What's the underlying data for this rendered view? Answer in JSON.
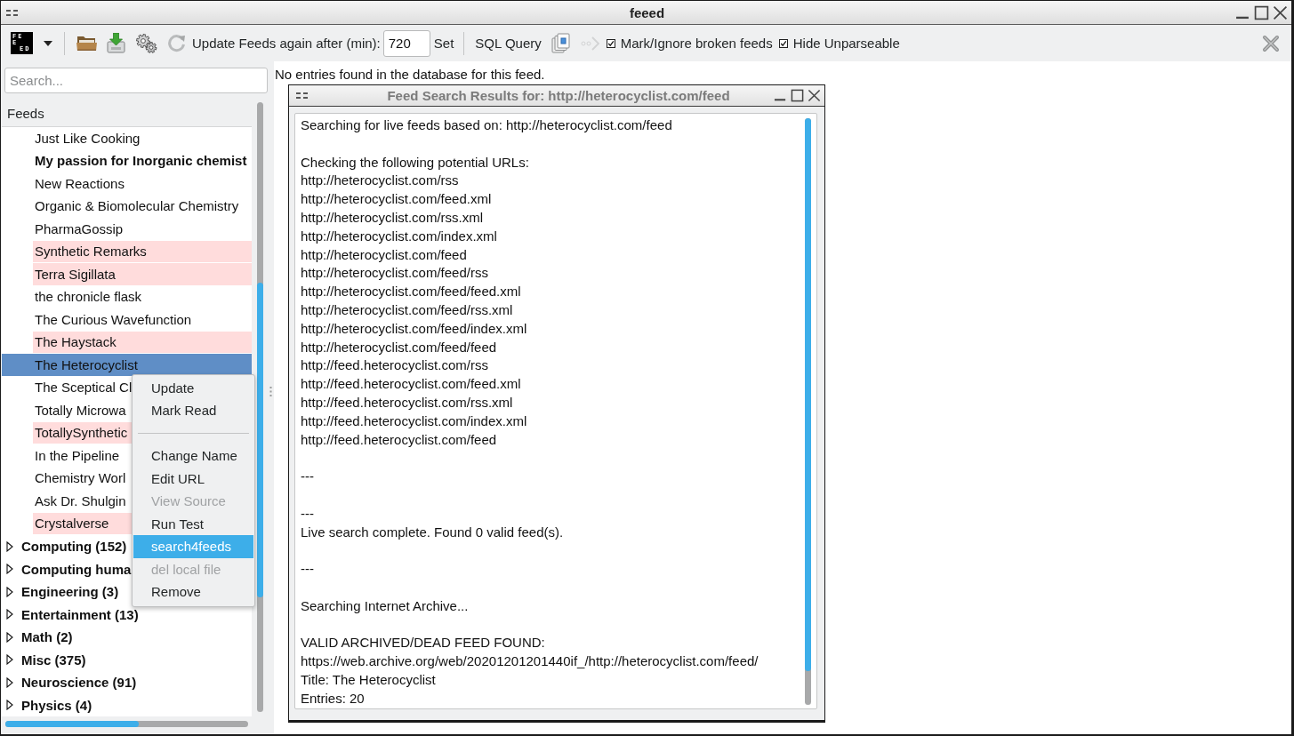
{
  "window": {
    "title": "feeed"
  },
  "toolbar": {
    "logo": [
      "FE",
      "E",
      "ED"
    ],
    "update_label": "Update Feeds again after (min):",
    "update_value": "720",
    "set_button": "Set",
    "sql_button": "SQL Query",
    "checkboxes": [
      {
        "label": "Mark/Ignore broken feeds",
        "checked": true
      },
      {
        "label": "Hide Unparseable",
        "checked": true
      }
    ]
  },
  "sidebar": {
    "search": {
      "placeholder": "Search..."
    },
    "tree": {
      "header": "Feeds",
      "items": [
        {
          "children": [
            {
              "label": "Just Like Cooking",
              "unread": false,
              "broken": false,
              "selected": false
            },
            {
              "label": "My passion for Inorganic chemist",
              "unread": true,
              "broken": false,
              "selected": false
            },
            {
              "label": "New Reactions",
              "unread": false,
              "broken": false,
              "selected": false
            },
            {
              "label": "Organic & Biomolecular Chemistry",
              "unread": false,
              "broken": false,
              "selected": false
            },
            {
              "label": "PharmaGossip",
              "unread": false,
              "broken": false,
              "selected": false
            },
            {
              "label": "Synthetic Remarks",
              "unread": false,
              "broken": true,
              "selected": false
            },
            {
              "label": "Terra Sigillata",
              "unread": false,
              "broken": true,
              "selected": false
            },
            {
              "label": "the chronicle flask",
              "unread": false,
              "broken": false,
              "selected": false
            },
            {
              "label": "The Curious Wavefunction",
              "unread": false,
              "broken": false,
              "selected": false
            },
            {
              "label": "The Haystack",
              "unread": false,
              "broken": true,
              "selected": false
            },
            {
              "label": "The Heterocyclist",
              "unread": false,
              "broken": false,
              "selected": true
            },
            {
              "label": "The Sceptical Cl",
              "unread": false,
              "broken": false,
              "selected": false
            },
            {
              "label": "Totally Microwa",
              "unread": false,
              "broken": false,
              "selected": false
            },
            {
              "label": "TotallySynthetic",
              "unread": false,
              "broken": true,
              "selected": false
            },
            {
              "label": "In the Pipeline",
              "unread": false,
              "broken": false,
              "selected": false
            },
            {
              "label": "Chemistry Worl",
              "unread": false,
              "broken": false,
              "selected": false
            },
            {
              "label": "Ask Dr. Shulgin",
              "unread": false,
              "broken": false,
              "selected": false
            },
            {
              "label": "Crystalverse",
              "unread": false,
              "broken": true,
              "selected": false
            }
          ]
        },
        {
          "label": "Computing (152)",
          "expanded": false,
          "selected": false
        },
        {
          "label": "Computing huma",
          "expanded": false,
          "selected": false
        },
        {
          "label": "Engineering (3)",
          "expanded": false,
          "selected": false
        },
        {
          "label": "Entertainment (13)",
          "expanded": false,
          "selected": false
        },
        {
          "label": "Math (2)",
          "expanded": false,
          "selected": false
        },
        {
          "label": "Misc (375)",
          "expanded": false,
          "selected": false
        },
        {
          "label": "Neuroscience (91)",
          "expanded": false,
          "selected": false
        },
        {
          "label": "Physics (4)",
          "expanded": false,
          "selected": false
        }
      ]
    }
  },
  "context_menu": {
    "items": [
      {
        "kind": "action",
        "label": "Update",
        "disabled": false,
        "selected": false
      },
      {
        "kind": "action",
        "label": "Mark Read",
        "disabled": false,
        "selected": false
      },
      {
        "kind": "separator"
      },
      {
        "kind": "action",
        "label": "Change Name",
        "disabled": false,
        "selected": false
      },
      {
        "kind": "action",
        "label": "Edit URL",
        "disabled": false,
        "selected": false
      },
      {
        "kind": "action",
        "label": "View Source",
        "disabled": true,
        "selected": false
      },
      {
        "kind": "action",
        "label": "Run Test",
        "disabled": false,
        "selected": false
      },
      {
        "kind": "action",
        "label": "search4feeds",
        "disabled": false,
        "selected": true
      },
      {
        "kind": "action",
        "label": "del local file",
        "disabled": true,
        "selected": false
      },
      {
        "kind": "action",
        "label": "Remove",
        "disabled": false,
        "selected": false
      }
    ]
  },
  "content": {
    "message": "No entries found in the database for this feed."
  },
  "dialog": {
    "title": "Feed Search Results for: http://heterocyclist.com/feed",
    "active": false,
    "blocks": [
      [
        "Searching for live feeds based on: http://heterocyclist.com/feed"
      ],
      [
        "Checking the following potential URLs:",
        "http://heterocyclist.com/rss",
        "http://heterocyclist.com/feed.xml",
        "http://heterocyclist.com/rss.xml",
        "http://heterocyclist.com/index.xml",
        "http://heterocyclist.com/feed",
        "http://heterocyclist.com/feed/rss",
        "http://heterocyclist.com/feed/feed.xml",
        "http://heterocyclist.com/feed/rss.xml",
        "http://heterocyclist.com/feed/index.xml",
        "http://heterocyclist.com/feed/feed",
        "http://feed.heterocyclist.com/rss",
        "http://feed.heterocyclist.com/feed.xml",
        "http://feed.heterocyclist.com/rss.xml",
        "http://feed.heterocyclist.com/index.xml",
        "http://feed.heterocyclist.com/feed"
      ],
      [
        "---"
      ],
      [
        "---",
        "Live search complete. Found 0 valid feed(s)."
      ],
      [
        "---"
      ],
      [
        "Searching Internet Archive..."
      ],
      [
        "VALID ARCHIVED/DEAD FEED FOUND:",
        "https://web.archive.org/web/20201201201440if_/http://heterocyclist.com/feed/",
        "Title: The Heterocyclist",
        "Entries: 20"
      ]
    ]
  }
}
